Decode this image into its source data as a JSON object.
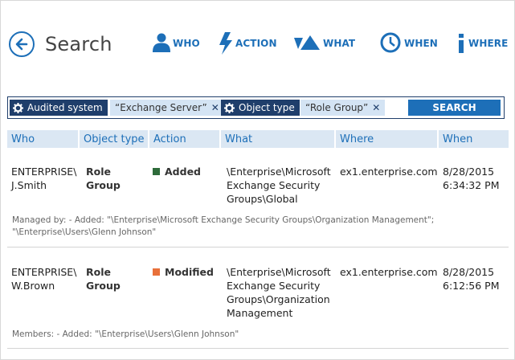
{
  "header": {
    "title": "Search",
    "nav": [
      {
        "id": "who",
        "label": "WHO",
        "icon": "person-icon"
      },
      {
        "id": "action",
        "label": "ACTION",
        "icon": "lightning-icon"
      },
      {
        "id": "what",
        "label": "WHAT",
        "icon": "shapes-icon"
      },
      {
        "id": "when",
        "label": "WHEN",
        "icon": "clock-icon"
      },
      {
        "id": "where",
        "label": "WHERE",
        "icon": "info-icon"
      }
    ]
  },
  "filters": [
    {
      "key": "Audited system",
      "value": "“Exchange Server”",
      "remove": "✕"
    },
    {
      "key": "Object type",
      "value": "“Role Group”",
      "remove": "✕"
    }
  ],
  "search_button": "SEARCH",
  "table": {
    "columns": [
      "Who",
      "Object type",
      "Action",
      "What",
      "Where",
      "When"
    ],
    "rows": [
      {
        "who": [
          "ENTERPRISE\\",
          "J.Smith"
        ],
        "object_type": [
          "Role",
          "Group"
        ],
        "action": "Added",
        "action_color": "#2e6b3a",
        "what": [
          "\\Enterprise\\Microsoft",
          "Exchange Security",
          "Groups\\Global"
        ],
        "where": "ex1.enterprise.com",
        "when": [
          "8/28/2015",
          "6:34:32 PM"
        ],
        "detail": [
          "Managed by: - Added: \"\\Enterprise\\Microsoft Exchange Security Groups\\Organization Management\";",
          "\"\\Enterprise\\Users\\Glenn Johnson\""
        ]
      },
      {
        "who": [
          "ENTERPRISE\\",
          "W.Brown"
        ],
        "object_type": [
          "Role",
          "Group"
        ],
        "action": "Modified",
        "action_color": "#e8703a",
        "what": [
          "\\Enterprise\\Microsoft",
          "Exchange Security",
          "Groups\\Organization",
          "Management"
        ],
        "where": "ex1.enterprise.com",
        "when": [
          "8/28/2015",
          "6:12:56 PM"
        ],
        "detail": [
          "Members: - Added: \"\\Enterprise\\Users\\Glenn Johnson\""
        ]
      }
    ]
  },
  "colors": {
    "accent": "#1d6fb8",
    "dark": "#1f3e6b",
    "header_bg": "#dbe7f3",
    "chip_value_bg": "#d4e4f4"
  }
}
